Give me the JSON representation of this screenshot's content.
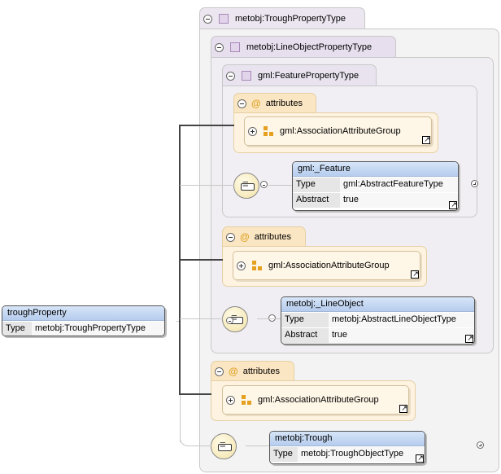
{
  "root_element": {
    "name": "troughProperty",
    "type_key": "Type",
    "type_value": "metobj:TroughPropertyType"
  },
  "complex_types": [
    {
      "name": "metobj:TroughPropertyType"
    },
    {
      "name": "metobj:LineObjectPropertyType"
    },
    {
      "name": "gml:FeaturePropertyType"
    }
  ],
  "attributes_label": "attributes",
  "attribute_group": "gml:AssociationAttributeGroup",
  "elements": [
    {
      "name": "gml:_Feature",
      "type_key": "Type",
      "type_value": "gml:AbstractFeatureType",
      "abstract_key": "Abstract",
      "abstract_value": "true"
    },
    {
      "name": "metobj:_LineObject",
      "type_key": "Type",
      "type_value": "metobj:AbstractLineObjectType",
      "abstract_key": "Abstract",
      "abstract_value": "true"
    },
    {
      "name": "metobj:Trough",
      "type_key": "Type",
      "type_value": "metobj:TroughObjectType"
    }
  ],
  "colors": {
    "element_header": "#c4d7f2",
    "attribute_panel": "#fdf3e0",
    "type_panel": "#f3f3f3",
    "group_icon": "#e6a020"
  }
}
